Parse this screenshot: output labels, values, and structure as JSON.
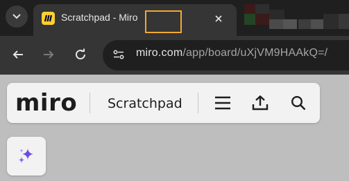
{
  "browser": {
    "tab": {
      "title_prefix": "Scratchpad",
      "title_suffix": " - Miro",
      "favicon": "miro-logo-icon"
    },
    "address_bar": {
      "domain": "miro.com",
      "path": "/app/board/uXjVM9HAAkQ=/"
    },
    "icons": {
      "tab_dropdown": "chevron-down-icon",
      "close": "close-icon",
      "back": "arrow-left-icon",
      "forward": "arrow-right-icon",
      "reload": "reload-icon",
      "site_info": "tune-icon"
    },
    "colors": {
      "highlight": "#f3a833",
      "tabstrip": "#1f1f1f",
      "toolbar": "#353535"
    }
  },
  "miro": {
    "logo": "miro",
    "board_name": "Scratchpad",
    "icons": {
      "menu": "hamburger-menu-icon",
      "share": "upload-icon",
      "search": "search-icon",
      "ai": "sparkles-icon"
    },
    "colors": {
      "ai_accent": "#6b4ae8",
      "canvas": "#bebebe"
    }
  }
}
